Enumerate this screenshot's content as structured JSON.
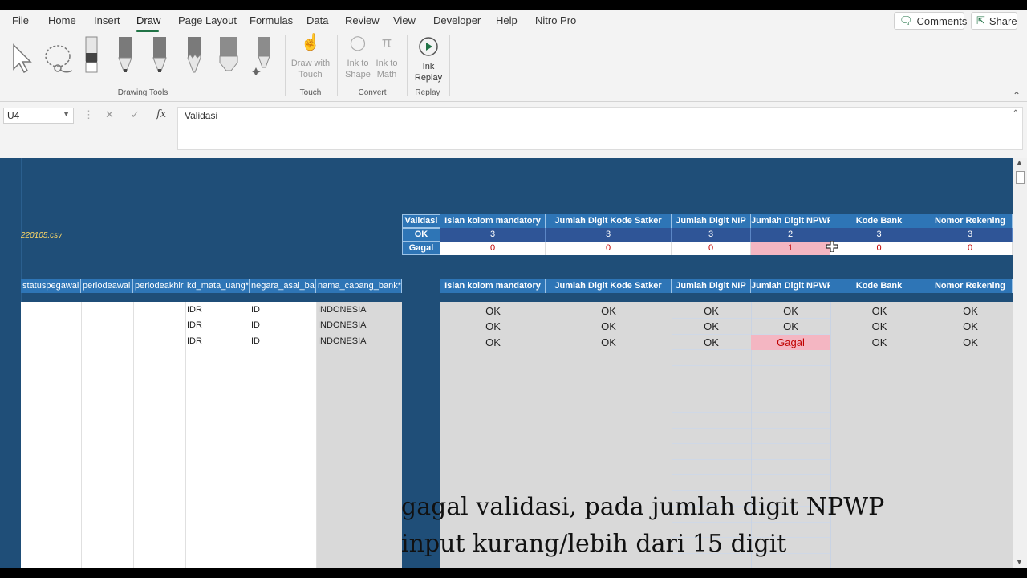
{
  "menu": {
    "file": "File",
    "home": "Home",
    "insert": "Insert",
    "draw": "Draw",
    "page_layout": "Page Layout",
    "formulas": "Formulas",
    "data": "Data",
    "review": "Review",
    "view": "View",
    "developer": "Developer",
    "help": "Help",
    "nitro": "Nitro Pro",
    "comments": "Comments",
    "share": "Share"
  },
  "ribbon": {
    "drawing_tools": "Drawing Tools",
    "draw_with_touch": [
      "Draw with",
      "Touch"
    ],
    "touch": "Touch",
    "ink_to_shape": [
      "Ink to",
      "Shape"
    ],
    "ink_to_math": [
      "Ink to",
      "Math"
    ],
    "convert": "Convert",
    "ink_replay": [
      "Ink",
      "Replay"
    ],
    "replay": "Replay"
  },
  "formula_bar": {
    "name_box": "U4",
    "fx": "fx",
    "content": "Validasi"
  },
  "sheet": {
    "file_label": "220105.csv",
    "summary": {
      "validasi": "Validasi",
      "ok": "OK",
      "gagal": "Gagal",
      "columns": [
        "Isian kolom mandatory",
        "Jumlah Digit Kode Satker",
        "Jumlah Digit NIP",
        "Jumlah Digit NPWP",
        "Kode Bank",
        "Nomor Rekening"
      ],
      "ok_counts": [
        "3",
        "3",
        "3",
        "2",
        "3",
        "3"
      ],
      "gagal_counts": [
        "0",
        "0",
        "0",
        "1",
        "0",
        "0"
      ]
    },
    "data_headers": [
      "statuspegawai",
      "periodeawal",
      "periodeakhir",
      "kd_mata_uang*",
      "negara_asal_bank*",
      "nama_cabang_bank*"
    ],
    "rows": [
      [
        "IDR",
        "ID",
        "INDONESIA"
      ],
      [
        "IDR",
        "ID",
        "INDONESIA"
      ],
      [
        "IDR",
        "ID",
        "INDONESIA"
      ]
    ],
    "result_headers": [
      "Isian kolom mandatory",
      "Jumlah Digit Kode Satker",
      "Jumlah Digit NIP",
      "Jumlah Digit NPWP",
      "Kode Bank",
      "Nomor Rekening"
    ],
    "results": [
      [
        "OK",
        "OK",
        "OK",
        "OK",
        "OK",
        "OK"
      ],
      [
        "OK",
        "OK",
        "OK",
        "OK",
        "OK",
        "OK"
      ],
      [
        "OK",
        "OK",
        "OK",
        "Gagal",
        "OK",
        "OK"
      ]
    ]
  },
  "subtitle": {
    "line1": "gagal validasi, pada jumlah digit NPWP",
    "line2": "input kurang/lebih dari 15 digit"
  },
  "colors": {
    "accent": "#217346",
    "header_blue": "#2e75b6",
    "sheet_bg": "#1f4e78",
    "fail_pink": "#f4b6c2",
    "fail_red": "#c00000"
  }
}
